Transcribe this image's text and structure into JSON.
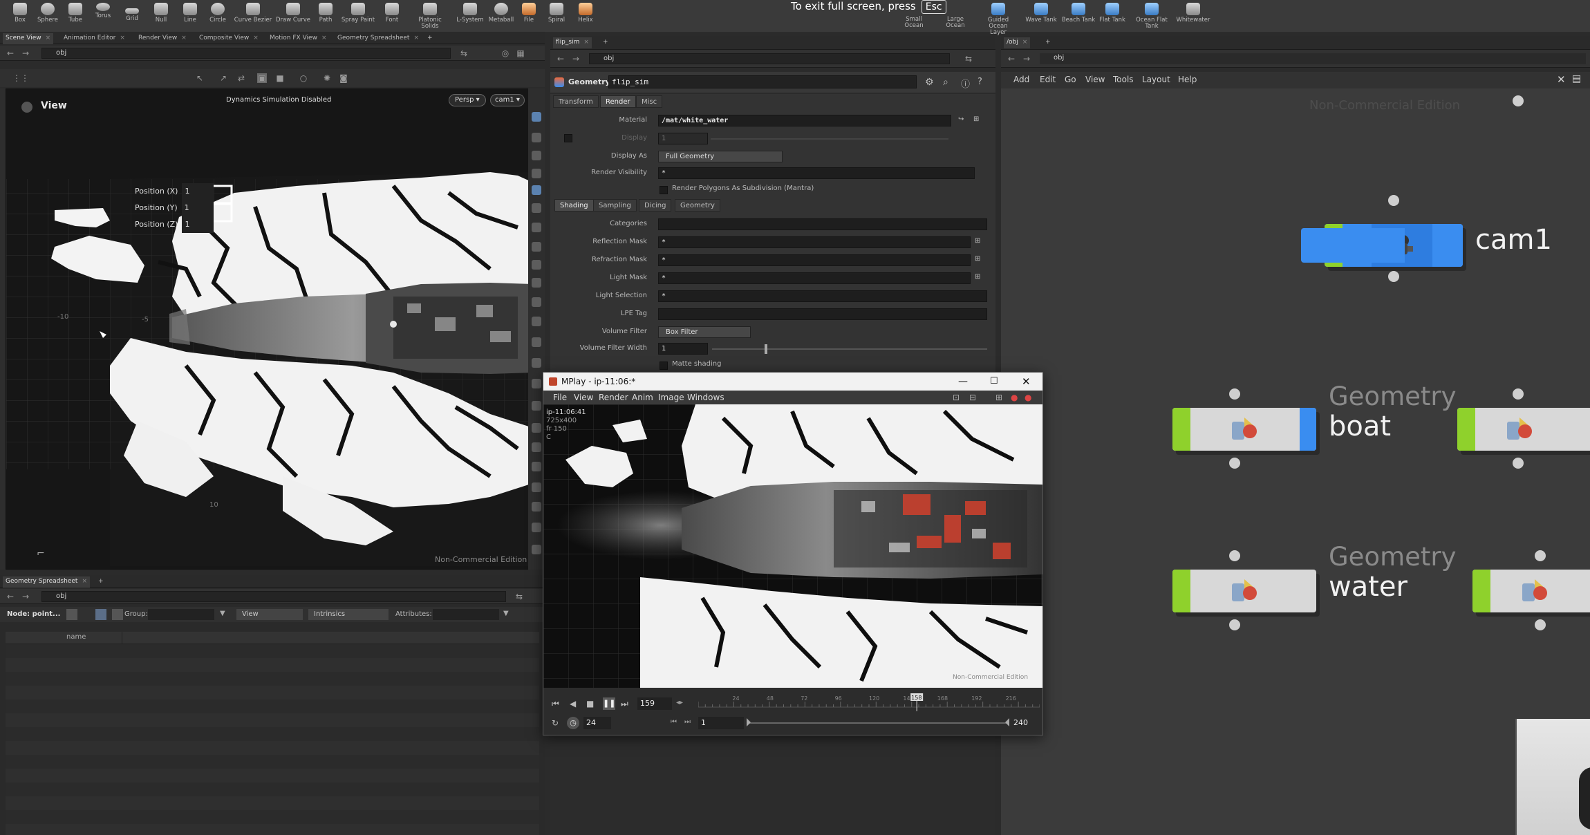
{
  "shelf": {
    "tools": [
      "Box",
      "Sphere",
      "Tube",
      "Torus",
      "Grid",
      "Null",
      "Line",
      "Circle",
      "Curve Bezier",
      "Draw Curve",
      "Path",
      "Spray Paint",
      "Font",
      "Platonic Solids",
      "L-System",
      "Metaball",
      "File",
      "Spiral",
      "Helix"
    ],
    "tools_right": [
      "Small Ocean",
      "Large Ocean",
      "Guided Ocean Layer",
      "Wave Tank",
      "Beach Tank",
      "Flat Tank",
      "Ocean Flat Tank",
      "Whitewater"
    ],
    "fullscreen_text": "To exit full screen, press",
    "fullscreen_key": "Esc"
  },
  "left_pane": {
    "tabs": [
      "Scene View",
      "Animation Editor",
      "Render View",
      "Composite View",
      "Motion FX View",
      "Geometry Spreadsheet"
    ],
    "path": "obj",
    "view_label": "View",
    "sim_status": "Dynamics Simulation Disabled",
    "persp": "Persp",
    "camera": "cam1",
    "position_x_label": "Position (X)",
    "position_y_label": "Position (Y)",
    "position_z_label": "Position (Z)",
    "position_x": "1",
    "position_y": "1",
    "position_z": "1",
    "grid_labels": [
      "-10",
      "-5",
      "10"
    ],
    "watermark": "Non-Commercial Edition"
  },
  "spreadsheet": {
    "tab": "Geometry Spreadsheet",
    "path": "obj",
    "node_label": "Node: point...",
    "group_label": "Group:",
    "view_label": "View",
    "intrinsics_label": "Intrinsics",
    "attributes_label": "Attributes:",
    "col_name": "name"
  },
  "params": {
    "tab": "flip_sim",
    "path": "obj",
    "type_label": "Geometry",
    "node_name": "flip_sim",
    "tabs": [
      "Transform",
      "Render",
      "Misc"
    ],
    "material_label": "Material",
    "material_value": "/mat/white_water",
    "display_label": "Display",
    "display_value": "1",
    "display_as_label": "Display As",
    "display_as_value": "Full Geometry",
    "render_visibility_label": "Render Visibility",
    "render_visibility_value": "*",
    "render_polys_label": "Render Polygons As Subdivision (Mantra)",
    "subtabs": [
      "Shading",
      "Sampling",
      "Dicing",
      "Geometry"
    ],
    "categories_label": "Categories",
    "reflection_mask_label": "Reflection Mask",
    "reflection_mask_value": "*",
    "refraction_mask_label": "Refraction Mask",
    "refraction_mask_value": "*",
    "light_mask_label": "Light Mask",
    "light_mask_value": "*",
    "light_selection_label": "Light Selection",
    "light_selection_value": "*",
    "lpe_tag_label": "LPE Tag",
    "volume_filter_label": "Volume Filter",
    "volume_filter_value": "Box Filter",
    "volume_filter_width_label": "Volume Filter Width",
    "volume_filter_width_value": "1",
    "matte_label": "Matte shading"
  },
  "mplay": {
    "title": "MPlay - ip-11:06:*",
    "menu": [
      "File",
      "View",
      "Render",
      "Anim",
      "Image",
      "Windows"
    ],
    "overlay_time": "ip-11:06:41",
    "overlay_res": "725x400",
    "overlay_frame": "fr 150",
    "overlay_c": "C",
    "watermark": "Non-Commercial Edition",
    "frame": "159",
    "fps": "24",
    "range_start": "1",
    "range_end": "240",
    "timeline_ticks": [
      "24",
      "48",
      "72",
      "96",
      "120",
      "144",
      "168",
      "192",
      "216"
    ],
    "current_frame_marker": "158",
    "current_frame_fraction": 0.64
  },
  "network": {
    "tab": "/obj",
    "path": "obj",
    "menu": [
      "Add",
      "Edit",
      "Go",
      "View",
      "Tools",
      "Layout",
      "Help"
    ],
    "watermark": "Non-Commercial Edition",
    "nodes": [
      {
        "type": "",
        "name": "cam1"
      },
      {
        "type": "Geometry",
        "name": "boat"
      },
      {
        "type": "Geometry",
        "name": "water"
      }
    ]
  },
  "colors": {
    "node_green": "#8fd12c",
    "node_blue": "#3a8df0",
    "bg_network": "#3b3b3b"
  }
}
